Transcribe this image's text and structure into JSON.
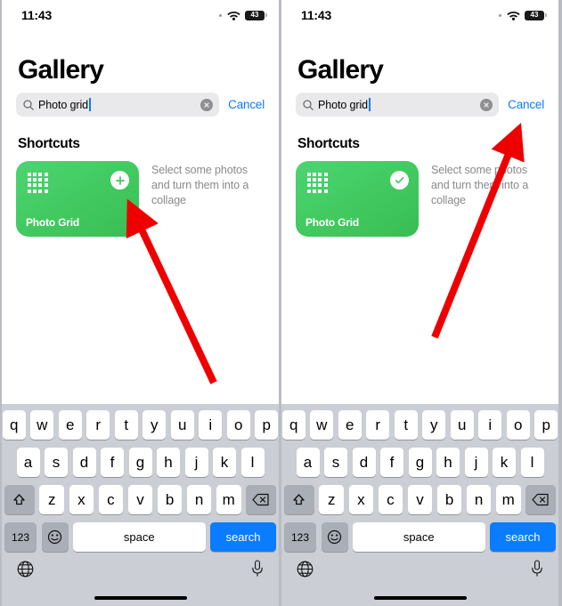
{
  "meta": {
    "accent_blue": "#0a7cff",
    "card_green": "#41c95f",
    "arrow_red": "#ee0000",
    "keyboard_bg": "#cbced4",
    "divider_gray": "#b9bcc2"
  },
  "panels": [
    {
      "id": "left",
      "status": {
        "time": "11:43",
        "wifi_icon": "wifi-icon",
        "signal_icon": "cellular-dot-icon",
        "battery_level": "43",
        "battery_icon": "battery-icon"
      },
      "title": "Gallery",
      "search": {
        "icon": "search-icon",
        "value": "Photo grid",
        "clear_icon": "clear-circle-icon",
        "cancel_label": "Cancel",
        "caret_visible": true
      },
      "section_title": "Shortcuts",
      "shortcut": {
        "icon": "grid-dots-icon",
        "name": "Photo Grid",
        "action_icon": "plus-icon",
        "description": "Select some photos and turn them into a collage"
      },
      "arrow": {
        "name": "pointer-arrow-to-add-button",
        "from": [
          238,
          430
        ],
        "to": [
          139,
          221
        ]
      }
    },
    {
      "id": "right",
      "status": {
        "time": "11:43",
        "wifi_icon": "wifi-icon",
        "signal_icon": "cellular-dot-icon",
        "battery_level": "43",
        "battery_icon": "battery-icon"
      },
      "title": "Gallery",
      "search": {
        "icon": "search-icon",
        "value": "Photo grid",
        "clear_icon": "clear-circle-icon",
        "cancel_label": "Cancel",
        "caret_visible": true
      },
      "section_title": "Shortcuts",
      "shortcut": {
        "icon": "grid-dots-icon",
        "name": "Photo Grid",
        "action_icon": "checkmark-icon",
        "description": "Select some photos and turn them into a collage"
      },
      "arrow": {
        "name": "pointer-arrow-to-cancel",
        "from": [
          172,
          379
        ],
        "to": [
          268,
          138
        ]
      }
    }
  ],
  "keyboard": {
    "row1": [
      "q",
      "w",
      "e",
      "r",
      "t",
      "y",
      "u",
      "i",
      "o",
      "p"
    ],
    "row2": [
      "a",
      "s",
      "d",
      "f",
      "g",
      "h",
      "j",
      "k",
      "l"
    ],
    "row3": [
      "z",
      "x",
      "c",
      "v",
      "b",
      "n",
      "m"
    ],
    "shift_icon": "shift-arrow-icon",
    "backspace_icon": "backspace-icon",
    "numbers_label": "123",
    "emoji_icon": "emoji-smiley-icon",
    "space_label": "space",
    "return_label": "search",
    "globe_icon": "globe-icon",
    "mic_icon": "microphone-icon"
  }
}
